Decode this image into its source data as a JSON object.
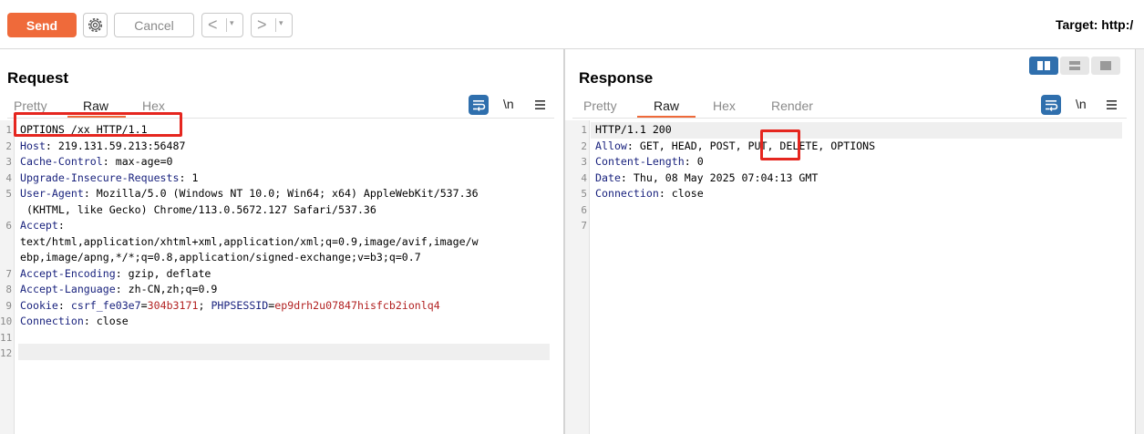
{
  "toolbar": {
    "send_label": "Send",
    "cancel_label": "Cancel",
    "back_arrow": "<",
    "forward_arrow": ">",
    "dropdown": "▾",
    "target_label": "Target: http:/"
  },
  "request": {
    "title": "Request",
    "tabs": [
      "Pretty",
      "Raw",
      "Hex"
    ],
    "active_tab": "Raw",
    "newline_label": "\\n",
    "lines": [
      {
        "n": "1",
        "segs": [
          {
            "t": "OPTIONS /xx HTTP/1.1",
            "c": "val"
          }
        ]
      },
      {
        "n": "2",
        "segs": [
          {
            "t": "Host",
            "c": "hdr"
          },
          {
            "t": ": 219.131.59.213:56487",
            "c": "val"
          }
        ]
      },
      {
        "n": "3",
        "segs": [
          {
            "t": "Cache-Control",
            "c": "hdr"
          },
          {
            "t": ": max-age=0",
            "c": "val"
          }
        ]
      },
      {
        "n": "4",
        "segs": [
          {
            "t": "Upgrade-Insecure-Requests",
            "c": "hdr"
          },
          {
            "t": ": 1",
            "c": "val"
          }
        ]
      },
      {
        "n": "5",
        "segs": [
          {
            "t": "User-Agent",
            "c": "hdr"
          },
          {
            "t": ": Mozilla/5.0 (Windows NT 10.0; Win64; x64) AppleWebKit/537.36",
            "c": "val"
          }
        ]
      },
      {
        "n": "",
        "segs": [
          {
            "t": " (KHTML, like Gecko) Chrome/113.0.5672.127 Safari/537.36",
            "c": "val"
          }
        ]
      },
      {
        "n": "6",
        "segs": [
          {
            "t": "Accept",
            "c": "hdr"
          },
          {
            "t": ":",
            "c": "val"
          }
        ]
      },
      {
        "n": "",
        "segs": [
          {
            "t": "text/html,application/xhtml+xml,application/xml;q=0.9,image/avif,image/w",
            "c": "val"
          }
        ]
      },
      {
        "n": "",
        "segs": [
          {
            "t": "ebp,image/apng,*/*;q=0.8,application/signed-exchange;v=b3;q=0.7",
            "c": "val"
          }
        ]
      },
      {
        "n": "7",
        "segs": [
          {
            "t": "Accept-Encoding",
            "c": "hdr"
          },
          {
            "t": ": gzip, deflate",
            "c": "val"
          }
        ]
      },
      {
        "n": "8",
        "segs": [
          {
            "t": "Accept-Language",
            "c": "hdr"
          },
          {
            "t": ": zh-CN,zh;q=0.9",
            "c": "val"
          }
        ]
      },
      {
        "n": "9",
        "segs": [
          {
            "t": "Cookie",
            "c": "hdr"
          },
          {
            "t": ": ",
            "c": "val"
          },
          {
            "t": "csrf_fe03e7",
            "c": "ckname"
          },
          {
            "t": "=",
            "c": "val"
          },
          {
            "t": "304b3171",
            "c": "ckval"
          },
          {
            "t": "; ",
            "c": "val"
          },
          {
            "t": "PHPSESSID",
            "c": "ckname"
          },
          {
            "t": "=",
            "c": "val"
          },
          {
            "t": "ep9drh2u07847hisfcb2ionlq4",
            "c": "ckval"
          }
        ]
      },
      {
        "n": "10",
        "segs": [
          {
            "t": "Connection",
            "c": "hdr"
          },
          {
            "t": ": close",
            "c": "val"
          }
        ]
      },
      {
        "n": "11",
        "segs": []
      },
      {
        "n": "12",
        "segs": []
      }
    ]
  },
  "response": {
    "title": "Response",
    "tabs": [
      "Pretty",
      "Raw",
      "Hex",
      "Render"
    ],
    "active_tab": "Raw",
    "newline_label": "\\n",
    "lines": [
      {
        "n": "1",
        "segs": [
          {
            "t": "HTTP/1.1 200",
            "c": "val"
          }
        ]
      },
      {
        "n": "2",
        "segs": [
          {
            "t": "Allow",
            "c": "hdr"
          },
          {
            "t": ": GET, HEAD, POST, PUT, DELETE, OPTIONS",
            "c": "val"
          }
        ]
      },
      {
        "n": "3",
        "segs": [
          {
            "t": "Content-Length",
            "c": "hdr"
          },
          {
            "t": ": 0",
            "c": "val"
          }
        ]
      },
      {
        "n": "4",
        "segs": [
          {
            "t": "Date",
            "c": "hdr"
          },
          {
            "t": ": Thu, 08 May 2025 07:04:13 GMT",
            "c": "val"
          }
        ]
      },
      {
        "n": "5",
        "segs": [
          {
            "t": "Connection",
            "c": "hdr"
          },
          {
            "t": ": close",
            "c": "val"
          }
        ]
      },
      {
        "n": "6",
        "segs": []
      },
      {
        "n": "7",
        "segs": []
      }
    ]
  },
  "colors": {
    "accent": "#ef6a3a",
    "header_name": "#1a237e",
    "cookie_value": "#b22222",
    "annotation": "#e5261f",
    "icon_blue": "#2f6fad"
  }
}
